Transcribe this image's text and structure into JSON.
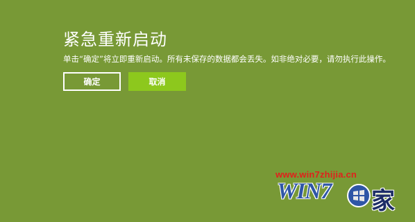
{
  "dialog": {
    "title": "紧急重新启动",
    "message": "单击“确定”将立即重新启动。所有未保存的数据都会丢失。如非绝对必要，请勿执行此操作。",
    "ok_label": "确定",
    "cancel_label": "取消"
  },
  "watermark": {
    "url": "www.win7zhijia.cn",
    "logo_text": "WIN7",
    "logo_char": "家"
  },
  "colors": {
    "background": "#789936",
    "cancel_button": "#8dc81d",
    "watermark_url": "#e0211c",
    "watermark_logo": "#2f56a6"
  },
  "icons": {
    "logo_orb": "windows-orb-icon"
  }
}
